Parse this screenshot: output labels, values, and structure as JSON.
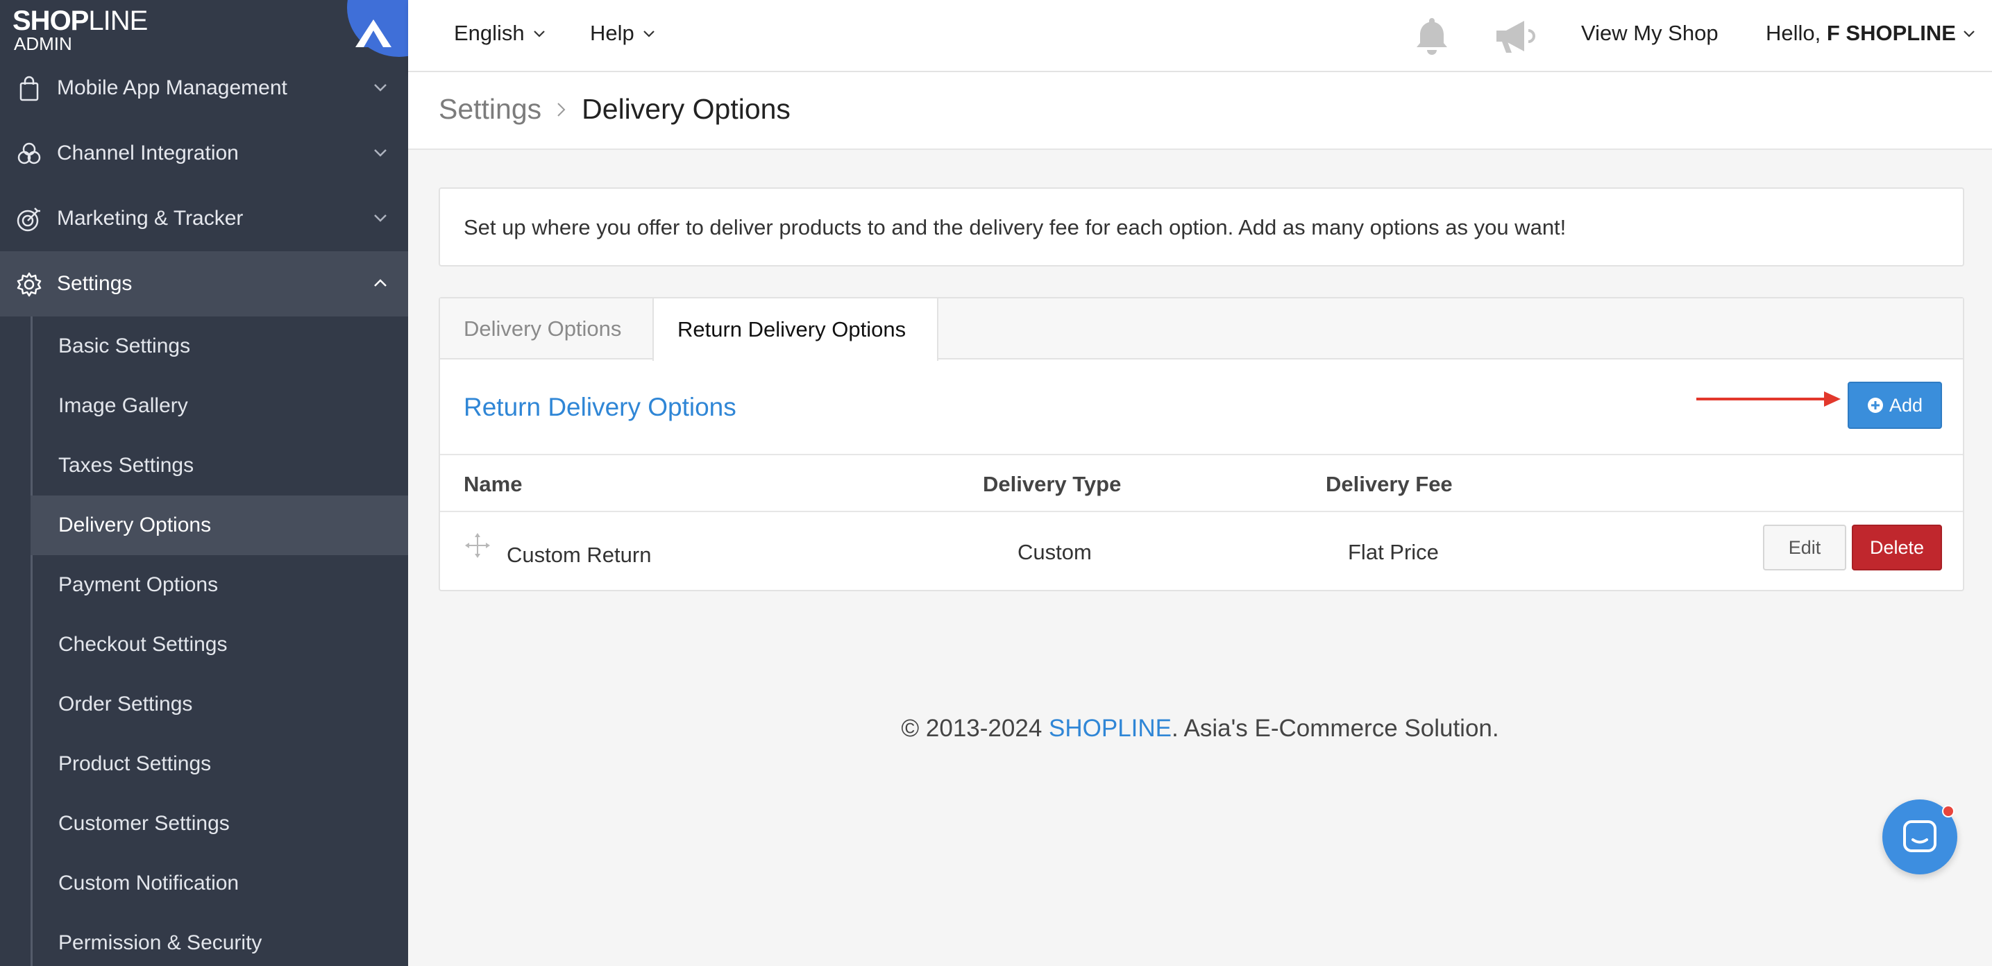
{
  "logo": {
    "brand_bold": "SHOP",
    "brand_thin": "LINE",
    "sub": "ADMIN"
  },
  "sidebar": {
    "items": [
      {
        "label": "Mobile App Management",
        "icon": "shopping-bag-icon"
      },
      {
        "label": "Channel Integration",
        "icon": "channels-icon"
      },
      {
        "label": "Marketing & Tracker",
        "icon": "target-icon"
      },
      {
        "label": "Settings",
        "icon": "gear-icon",
        "expanded": true
      }
    ],
    "submenu": [
      {
        "label": "Basic Settings"
      },
      {
        "label": "Image Gallery"
      },
      {
        "label": "Taxes Settings"
      },
      {
        "label": "Delivery Options",
        "active": true
      },
      {
        "label": "Payment Options"
      },
      {
        "label": "Checkout Settings"
      },
      {
        "label": "Order Settings"
      },
      {
        "label": "Product Settings"
      },
      {
        "label": "Customer Settings"
      },
      {
        "label": "Custom Notification"
      },
      {
        "label": "Permission & Security"
      }
    ]
  },
  "topbar": {
    "language": "English",
    "help": "Help",
    "view_shop": "View My Shop",
    "greeting": "Hello, ",
    "user": "F SHOPLINE"
  },
  "breadcrumb": {
    "parent": "Settings",
    "current": "Delivery Options"
  },
  "intro": "Set up where you offer to deliver products to and the delivery fee for each option. Add as many options as you want!",
  "tabs": [
    {
      "label": "Delivery Options",
      "active": false
    },
    {
      "label": "Return Delivery Options",
      "active": true
    }
  ],
  "panel": {
    "title": "Return Delivery Options",
    "add_label": "Add"
  },
  "table": {
    "headers": {
      "name": "Name",
      "type": "Delivery Type",
      "fee": "Delivery Fee"
    },
    "rows": [
      {
        "name": "Custom Return",
        "type": "Custom",
        "fee": "Flat Price",
        "edit": "Edit",
        "delete": "Delete"
      }
    ]
  },
  "footer": {
    "prefix": "© 2013-2024 ",
    "brand": "SHOPLINE",
    "suffix": ". Asia's E-Commerce Solution."
  },
  "colors": {
    "sidebar_bg": "#333a48",
    "accent_blue": "#3a8edb",
    "link_blue": "#2f86d6",
    "danger_red": "#c0272d",
    "arrow_red": "#e2382c"
  }
}
